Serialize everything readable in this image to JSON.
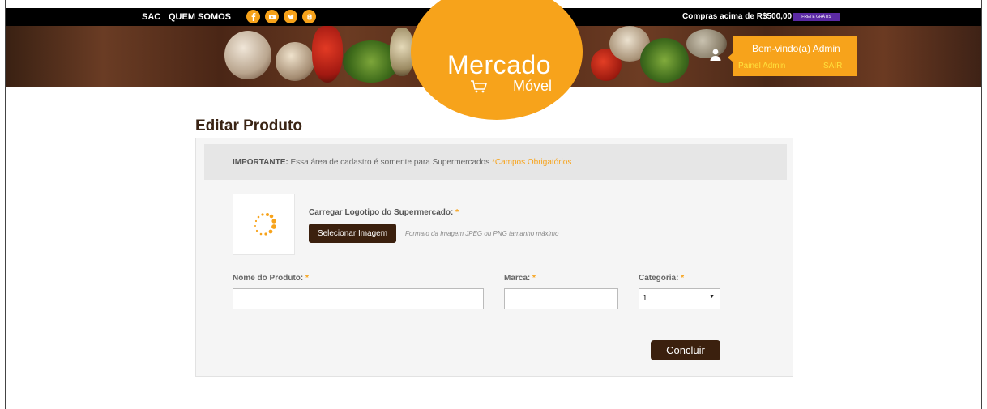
{
  "topbar": {
    "sac": "SAC",
    "quem_somos": "QUEM SOMOS",
    "social": [
      "facebook-icon",
      "youtube-icon",
      "twitter-icon",
      "blogger-icon"
    ],
    "promo": "Compras acima de R$500,00",
    "badge": "FRETE GRÁTIS"
  },
  "brand": {
    "name": "Mercado",
    "sub": "Móvel",
    "accent": "#f7a31b",
    "dark": "#3b200e"
  },
  "user": {
    "welcome": "Bem-vindo(a) Admin",
    "admin_link": "Painel Admin",
    "logout": "SAIR"
  },
  "page": {
    "title": "Editar Produto"
  },
  "notice": {
    "label": "IMPORTANTE:",
    "text": " Essa área de cadastro é somente para Supermercados ",
    "required": "*Campos Obrigatórios"
  },
  "upload": {
    "label": "Carregar Logotipo do Supermercado:",
    "star": " *",
    "button": "Selecionar Imagem",
    "hint": "Formato da Imagem JPEG ou PNG tamanho máximo"
  },
  "form": {
    "product_label": "Nome do Produto:",
    "product_value": "",
    "brand_label": "Marca:",
    "brand_value": "",
    "category_label": "Categoria:",
    "category_value": "1",
    "star": " *",
    "submit": "Concluir"
  }
}
